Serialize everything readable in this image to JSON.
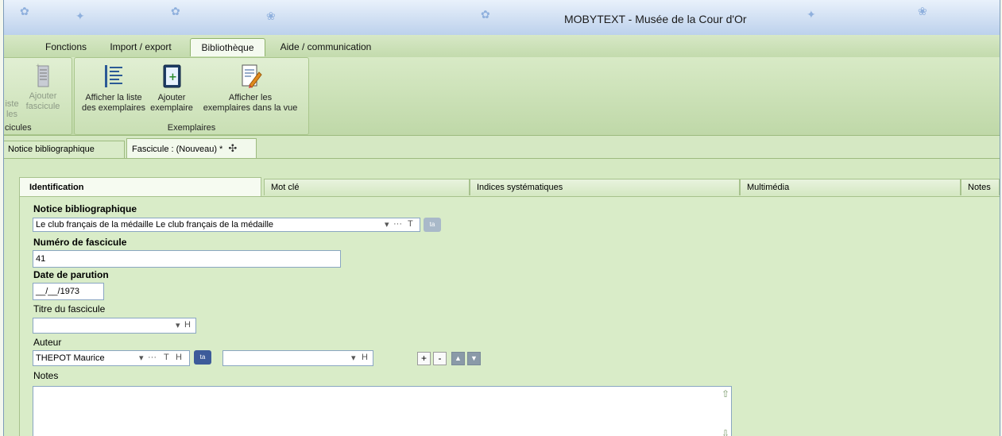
{
  "window": {
    "title": "MOBYTEXT - Musée de la Cour d'Or"
  },
  "ribbon_tabs": [
    {
      "label": "Fonctions"
    },
    {
      "label": "Import / export"
    },
    {
      "label": "Bibliothèque"
    },
    {
      "label": "Aide / communication"
    }
  ],
  "ribbon": {
    "group1": {
      "btn_liste": "iste\nles",
      "btn_ajouter": "Ajouter\nfascicule",
      "label": "cicules"
    },
    "group2": {
      "btn_afficher_liste": "Afficher la liste\ndes exemplaires",
      "btn_ajouter_exemplaire": "Ajouter\nexemplaire",
      "btn_afficher_vue": "Afficher les\nexemplaires dans la vue",
      "label": "Exemplaires"
    }
  },
  "doc_tabs": [
    {
      "label": "Notice bibliographique"
    },
    {
      "label": "Fascicule : (Nouveau) *"
    }
  ],
  "inner_tabs": [
    {
      "label": "Identification"
    },
    {
      "label": "Mot clé"
    },
    {
      "label": "Indices systématiques"
    },
    {
      "label": "Multimédia"
    },
    {
      "label": "Notes"
    }
  ],
  "form": {
    "notice_label": "Notice bibliographique",
    "notice_value": "Le club français de la médaille Le club français de la médaille",
    "numero_label": "Numéro de fascicule",
    "numero_value": "41",
    "date_label": "Date de parution",
    "date_value": "__/__/1973",
    "titre_label": "Titre du fascicule",
    "titre_value": "",
    "auteur_label": "Auteur",
    "auteur_value": "THEPOT Maurice",
    "auteur_role_value": "",
    "notes_label": "Notes",
    "notes_value": "",
    "ctl_dropdown": "▾",
    "ctl_more": "···",
    "ctl_t": "T",
    "ctl_h": "H",
    "tag_text": "ta",
    "plus": "+",
    "minus": "-",
    "up": "▲",
    "down": "▼"
  }
}
